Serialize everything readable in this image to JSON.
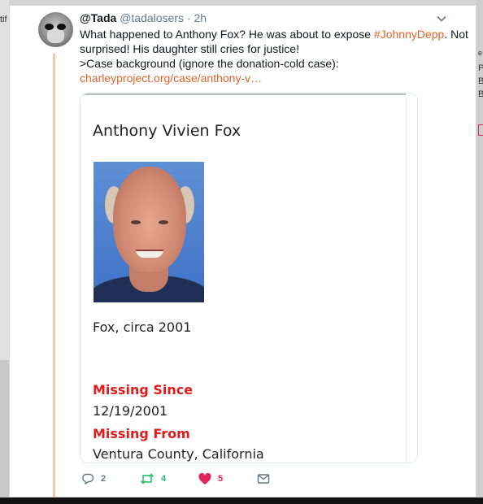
{
  "tweet": {
    "name": "@Tada",
    "handle": "@tadalosers",
    "separator": "·",
    "time": "2h",
    "text_line1_prefix": "What happened to Anthony Fox? He was about to expose ",
    "hashtag": "#JohnnyDepp",
    "text_line1_suffix": ". Not",
    "text_line2": "surprised! His daughter still cries for justice!",
    "text_line3": ">Case background (ignore the donation-cold case):",
    "link": "charleyproject.org/case/anthony-v…"
  },
  "card": {
    "title": "Anthony Vivien Fox",
    "caption": "Fox, circa 2001",
    "missing_since_label": "Missing Since",
    "missing_since_value": "12/19/2001",
    "missing_from_label": "Missing From",
    "missing_from_value": "Ventura County, California"
  },
  "actions": {
    "replies": "2",
    "retweets": "4",
    "likes": "5"
  },
  "background": {
    "frag1": "tif",
    "frag2": "e",
    "frag3": "P",
    "frag4": "B",
    "frag5": "B"
  },
  "colors": {
    "link": "#e0632c",
    "retweet": "#17bf63",
    "like": "#e0245e",
    "missing_label": "#e31b1b",
    "thread_line": "#f5c7a9"
  },
  "icons": {
    "reply": "reply-icon",
    "retweet": "retweet-icon",
    "like": "heart-icon",
    "dm": "envelope-icon",
    "menu": "chevron-down-icon"
  }
}
